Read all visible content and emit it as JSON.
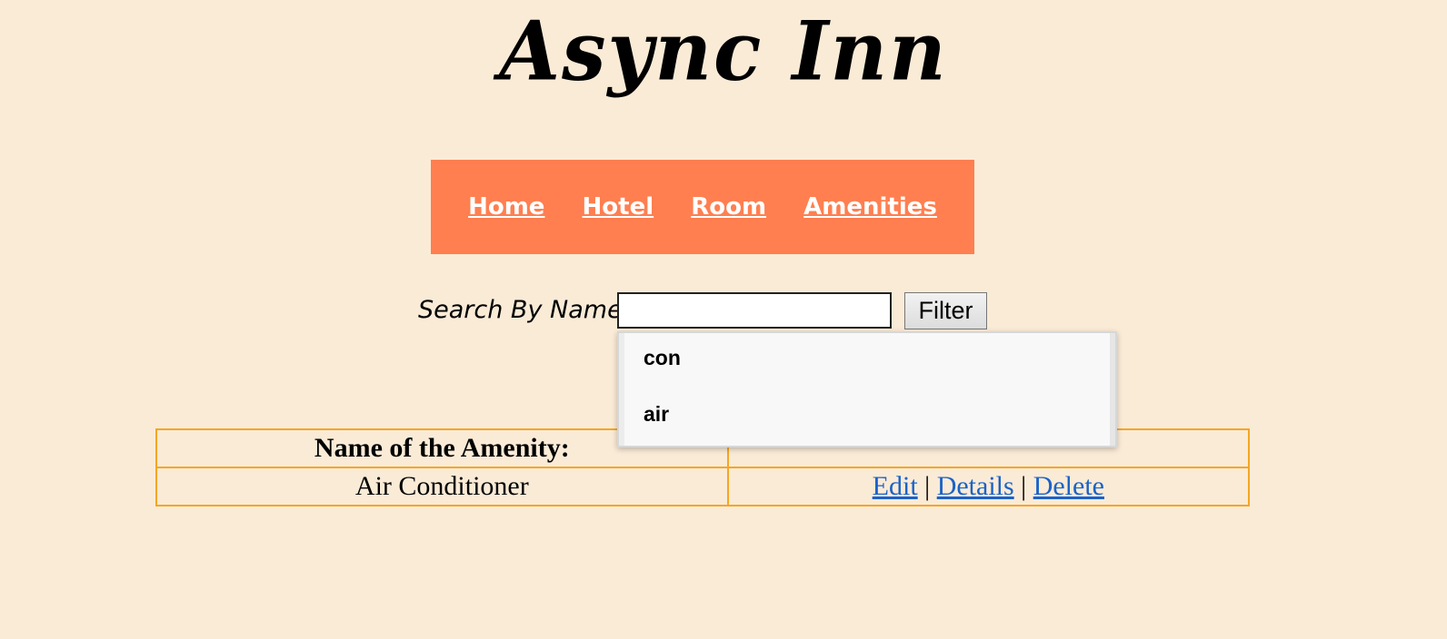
{
  "site": {
    "title": "Async Inn"
  },
  "nav": {
    "items": [
      {
        "label": "Home"
      },
      {
        "label": "Hotel"
      },
      {
        "label": "Room"
      },
      {
        "label": "Amenities"
      }
    ]
  },
  "search": {
    "label": "Search By Name:",
    "value": "",
    "button_label": "Filter",
    "suggestions": [
      "con",
      "air"
    ]
  },
  "table": {
    "headers": [
      "Name of the Amenity:",
      ""
    ],
    "rows": [
      {
        "name": "Air Conditioner",
        "actions": {
          "edit": "Edit",
          "sep1": "|",
          "details": "Details",
          "sep2": "|",
          "delete": "Delete"
        }
      }
    ]
  },
  "colors": {
    "background": "#faebd7",
    "nav_background": "#ff7f50",
    "table_border": "#f5a623",
    "link": "#1a62c9"
  }
}
